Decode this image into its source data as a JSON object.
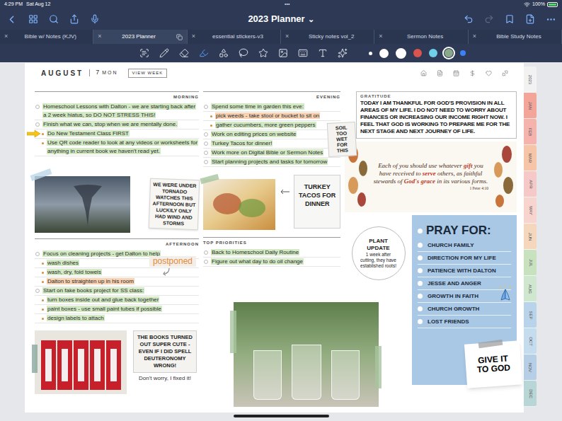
{
  "status_bar": {
    "time": "4:29 PM",
    "date": "Sat Aug 12",
    "dots": "•••",
    "battery": "100%",
    "battery_level": 1
  },
  "toolbar": {
    "title": "2023 Planner",
    "chevron": "⌄"
  },
  "tabs": [
    {
      "label": "Bible w/ Notes (KJV)",
      "selected": false,
      "close": "×"
    },
    {
      "label": "2023 Planner",
      "selected": true,
      "close": "×"
    },
    {
      "label": "essential stickers-v3",
      "selected": false,
      "close": "×"
    },
    {
      "label": "Sticky notes vol_2",
      "selected": false,
      "close": "×"
    },
    {
      "label": "Sermon Notes",
      "selected": false,
      "close": "×"
    },
    {
      "label": "Bible Study Notes",
      "selected": false,
      "close": "×"
    }
  ],
  "tools": [
    {
      "kind": "reader",
      "selected": false
    },
    {
      "kind": "pen",
      "selected": false
    },
    {
      "kind": "eraser",
      "selected": false
    },
    {
      "kind": "highlighter",
      "selected": true
    },
    {
      "kind": "shapes",
      "selected": false
    },
    {
      "kind": "lasso",
      "selected": false
    },
    {
      "kind": "sticker",
      "selected": false
    },
    {
      "kind": "image",
      "selected": false
    },
    {
      "kind": "keyboard",
      "selected": false
    },
    {
      "kind": "text",
      "selected": false
    },
    {
      "kind": "laser",
      "selected": false
    }
  ],
  "pen_colors": [
    {
      "color": "#ffffff",
      "selected": false
    },
    {
      "color": "#ffffff",
      "selected": false
    },
    {
      "color": "#ffffff",
      "selected": false
    },
    {
      "color": "#d9534f",
      "selected": false
    },
    {
      "color": "#6fd0e8",
      "selected": false
    },
    {
      "color": "#8aa88a",
      "selected": true
    },
    {
      "color": "#3b82f6",
      "selected": false
    }
  ],
  "page": {
    "month": "AUGUST",
    "day": "7",
    "weekday": "MON",
    "view_week": "VIEW WEEK"
  },
  "morning": {
    "label": "MORNING",
    "items": [
      {
        "text": "Homeschool Lessons with Dalton - we are starting back after a 2 week hiatus, so DO NOT STRESS THIS!",
        "kind": "main",
        "color": "#d3eac4",
        "marked": false
      },
      {
        "text": "Finish what we can, stop when we are mentally done.",
        "kind": "main",
        "color": "#d3eac4",
        "marked": false
      },
      {
        "text": "Do New Testament Class FIRST",
        "kind": "sub",
        "color": "#d3eac4",
        "marked": true
      },
      {
        "text": "Use QR code reader to look at any videos or worksheets for anything in current book we haven't read yet.",
        "kind": "sub",
        "color": "#d3eac4",
        "marked": false
      }
    ]
  },
  "evening": {
    "label": "EVENING",
    "items": [
      {
        "text": "Spend some time in garden this eve:",
        "kind": "main",
        "color": "#d3eac4",
        "marked": false
      },
      {
        "text": "pick weeds - take stool or bucket to sit on",
        "kind": "sub",
        "color": "#f9d2b2",
        "marked": false
      },
      {
        "text": "gather cucumbers, more green peppers",
        "kind": "sub",
        "color": "#d3eac4",
        "marked": false
      },
      {
        "text": "Work on editing prices on website",
        "kind": "main",
        "color": "#d3eac4",
        "marked": false
      },
      {
        "text": "Turkey Tacos for dinner!",
        "kind": "main",
        "color": "#d3eac4",
        "marked": false
      },
      {
        "text": "Work more on Digital Bible or Sermon Notes",
        "kind": "main",
        "color": "#d3eac4",
        "marked": false
      },
      {
        "text": "Start planning projects and tasks for tomorrow",
        "kind": "main",
        "color": "#d3eac4",
        "marked": false
      }
    ]
  },
  "afternoon": {
    "label": "AFTERNOON",
    "items": [
      {
        "text": "Focus on cleaning projects - get Dalton to help",
        "kind": "main",
        "color": "#d3eac4",
        "marked": false
      },
      {
        "text": "wash dishes",
        "kind": "sub",
        "color": "#d3eac4",
        "marked": false
      },
      {
        "text": "wash, dry, fold towels",
        "kind": "sub",
        "color": "#d3eac4",
        "marked": false
      },
      {
        "text": "Dalton to straighten up in his room",
        "kind": "sub",
        "color": "#f9d2b2",
        "marked": false
      },
      {
        "text": "Start on fake books project for SS class:",
        "kind": "main",
        "color": "#d3eac4",
        "marked": false
      },
      {
        "text": "turn boxes inside out and glue back together",
        "kind": "sub",
        "color": "#d3eac4",
        "marked": false
      },
      {
        "text": "paint boxes - use small paint tubes if possible",
        "kind": "sub",
        "color": "#d3eac4",
        "marked": false
      },
      {
        "text": "design labels to attach",
        "kind": "sub",
        "color": "#d3eac4",
        "marked": false
      }
    ]
  },
  "priorities": {
    "label": "TOP PRIORITIES",
    "items": [
      {
        "text": "Back to Homeschool Daily Routine",
        "kind": "main",
        "color": "#d3eac4",
        "marked": false
      },
      {
        "text": "Figure out what day to do oil change",
        "kind": "main",
        "color": "#d3eac4",
        "marked": false
      }
    ]
  },
  "notes": {
    "tornado": "WE WERE UNDER TORNADO WATCHES THIS AFTERNOON BUT LUCKILY ONLY HAD WIND AND STORMS",
    "soil": "SOIL TOO WET FOR THIS",
    "tacos": "TURKEY TACOS FOR DINNER",
    "books": "THE BOOKS TURNED OUT SUPER CUTE - EVEN IF I DID SPELL DEUTERONOMY WRONG!",
    "books_footer": "Don't worry, I fixed it!",
    "postponed": "postponed",
    "give": "GIVE IT TO GOD"
  },
  "plant_update": {
    "title": "PLANT UPDATE",
    "text": "1 week after cutting, they have established roots!"
  },
  "gratitude": {
    "label": "GRATITUDE",
    "text": "TODAY I AM THANKFUL FOR GOD'S PROVISION IN ALL AREAS OF MY LIFE. I DO NOT NEED TO WORRY ABOUT FINANCES OR INCREASING OUR INCOME RIGHT NOW. I FEEL THAT GOD IS WORKING TO PREPARE ME FOR THE NEXT STAGE AND NEXT JOURNEY OF LIFE."
  },
  "verse": {
    "parts": [
      {
        "text": "Each of you should use whatever ",
        "emphasis": false
      },
      {
        "text": "gift",
        "emphasis": true
      },
      {
        "text": " you have received to ",
        "emphasis": false
      },
      {
        "text": "serve",
        "emphasis": true
      },
      {
        "text": " others, as faithful stewards of ",
        "emphasis": false
      },
      {
        "text": "God's grace",
        "emphasis": true
      },
      {
        "text": " in its various forms.",
        "emphasis": false
      }
    ],
    "reference": "1 Peter 4:10"
  },
  "pray": {
    "title": "PRAY FOR:",
    "items": [
      "CHURCH FAMILY",
      "DIRECTION FOR MY LIFE",
      "PATIENCE WITH DALTON",
      "JESSE AND ANGER",
      "GROWTH IN FAITH",
      "CHURCH GROWTH",
      "LOST FRIENDS"
    ]
  },
  "side_tabs": [
    {
      "label": "2023",
      "color": "#f2f2f2"
    },
    {
      "label": "JAN",
      "color": "#f3a59a"
    },
    {
      "label": "FEB",
      "color": "#f4b3ad"
    },
    {
      "label": "MAR",
      "color": "#f6c4a6"
    },
    {
      "label": "APR",
      "color": "#f6c9c9"
    },
    {
      "label": "MAY",
      "color": "#f8d4cf"
    },
    {
      "label": "JUN",
      "color": "#f5d7bd"
    },
    {
      "label": "JUL",
      "color": "#c8e2bf"
    },
    {
      "label": "AUG",
      "color": "#d0e7cf"
    },
    {
      "label": "SEP",
      "color": "#b9d4ea"
    },
    {
      "label": "OCT",
      "color": "#c5dcef"
    },
    {
      "label": "NOV",
      "color": "#b7cfe6"
    },
    {
      "label": "DEC",
      "color": "#b8d6d6"
    }
  ]
}
